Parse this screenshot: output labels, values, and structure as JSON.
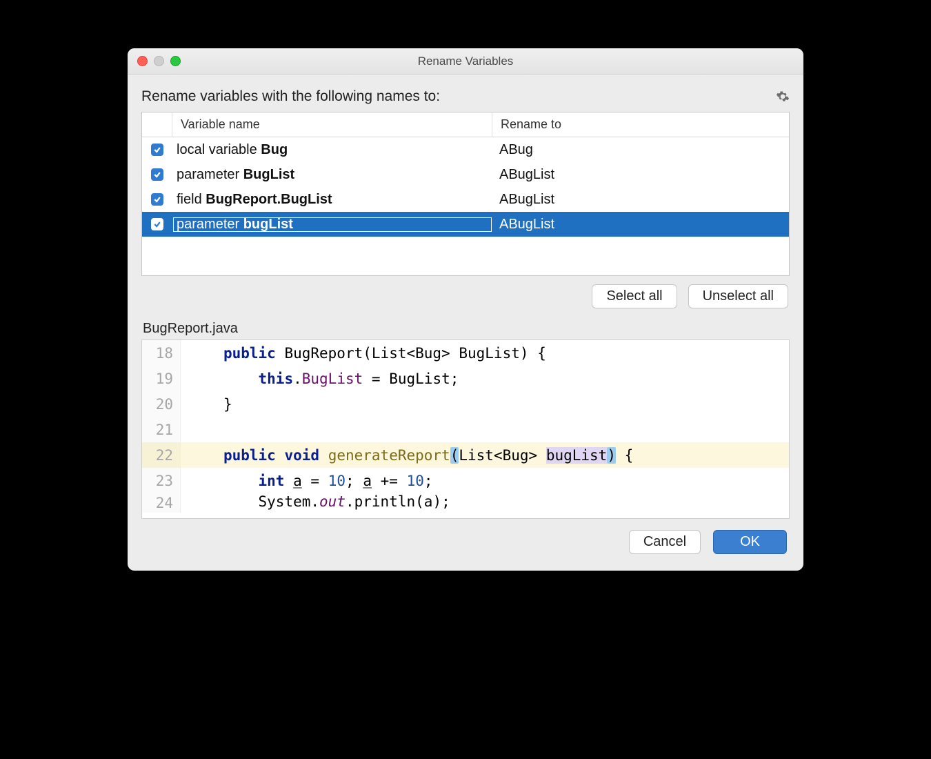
{
  "title": "Rename Variables",
  "instruction": "Rename variables with the following names to:",
  "columns": {
    "name": "Variable name",
    "to": "Rename to"
  },
  "rows": [
    {
      "checked": true,
      "selected": false,
      "kind": "local variable",
      "ident": "Bug",
      "to": "ABug"
    },
    {
      "checked": true,
      "selected": false,
      "kind": "parameter",
      "ident": "BugList",
      "to": "ABugList"
    },
    {
      "checked": true,
      "selected": false,
      "kind": "field",
      "ident": "BugReport.BugList",
      "to": "ABugList"
    },
    {
      "checked": true,
      "selected": true,
      "kind": "parameter",
      "ident": "bugList",
      "to": "ABugList"
    }
  ],
  "buttons": {
    "select_all": "Select all",
    "unselect_all": "Unselect all",
    "cancel": "Cancel",
    "ok": "OK"
  },
  "file": "BugReport.java",
  "code_lines": [
    {
      "n": 18,
      "hl": false
    },
    {
      "n": 19,
      "hl": false
    },
    {
      "n": 20,
      "hl": false
    },
    {
      "n": 21,
      "hl": false
    },
    {
      "n": 22,
      "hl": true
    },
    {
      "n": 23,
      "hl": false
    },
    {
      "n": 24,
      "hl": false
    }
  ],
  "code_tokens": {
    "public": "public",
    "void": "void",
    "int": "int",
    "this": "this",
    "class_ctor": "BugReport",
    "list_type": "List<Bug>",
    "p_BugList": "BugList",
    "p_bugList": "bugList",
    "m_generate": "generateReport",
    "a": "a",
    "ten": "10",
    "sys": "System",
    "out": "out",
    "println": "println",
    "semi": ";",
    "assign": "=",
    "plusassign": "+=",
    "obrace": "{",
    "cbrace": "}",
    "oparen": "(",
    "cparen": ")",
    "dot": ".",
    "comma_sp": " "
  }
}
